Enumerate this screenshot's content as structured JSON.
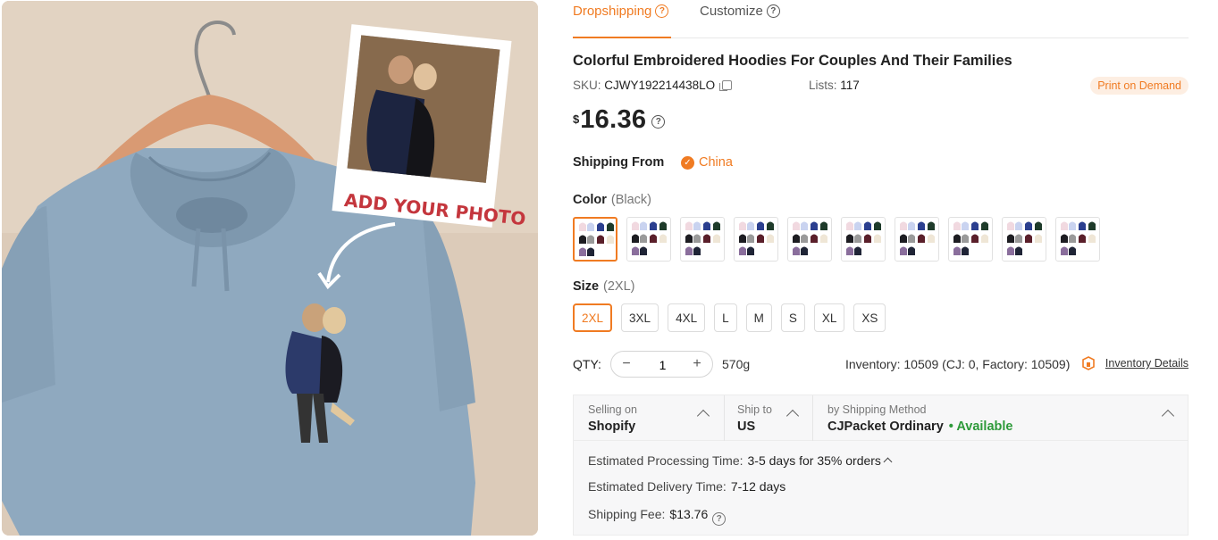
{
  "tabs": [
    {
      "label": "Dropshipping",
      "active": true
    },
    {
      "label": "Customize",
      "active": false
    }
  ],
  "product": {
    "title": "Colorful Embroidered Hoodies For Couples And Their Families",
    "sku_label": "SKU:",
    "sku": "CJWY192214438LO",
    "lists_label": "Lists:",
    "lists": "117",
    "badge": "Print on Demand",
    "currency": "$",
    "price": "16.36"
  },
  "hero_image": {
    "overlay_text": "ADD YOUR PHOTO"
  },
  "shipping_from": {
    "label": "Shipping From",
    "country": "China"
  },
  "color": {
    "label": "Color",
    "selected": "(Black)",
    "swatch_count": 10,
    "selected_index": 0
  },
  "size": {
    "label": "Size",
    "selected": "(2XL)",
    "options": [
      "2XL",
      "3XL",
      "4XL",
      "L",
      "M",
      "S",
      "XL",
      "XS"
    ],
    "selected_index": 0
  },
  "qty": {
    "label": "QTY:",
    "value": "1",
    "minus": "−",
    "plus": "+",
    "weight": "570g",
    "inventory": "Inventory: 10509  (CJ: 0, Factory: 10509)",
    "inventory_link": "Inventory Details"
  },
  "shipping": {
    "selling_on_label": "Selling on",
    "selling_on": "Shopify",
    "ship_to_label": "Ship to",
    "ship_to": "US",
    "method_label": "by Shipping Method",
    "method": "CJPacket Ordinary",
    "availability": "• Available",
    "processing_label": "Estimated Processing Time:",
    "processing": "3-5 days for 35% orders",
    "delivery_label": "Estimated Delivery Time:",
    "delivery": "7-12 days",
    "fee_label": "Shipping Fee:",
    "fee": "$13.76"
  },
  "colors": {
    "accent": "#f07b22",
    "available": "#2e9a3a",
    "hoodie": "#8fa9bf"
  }
}
